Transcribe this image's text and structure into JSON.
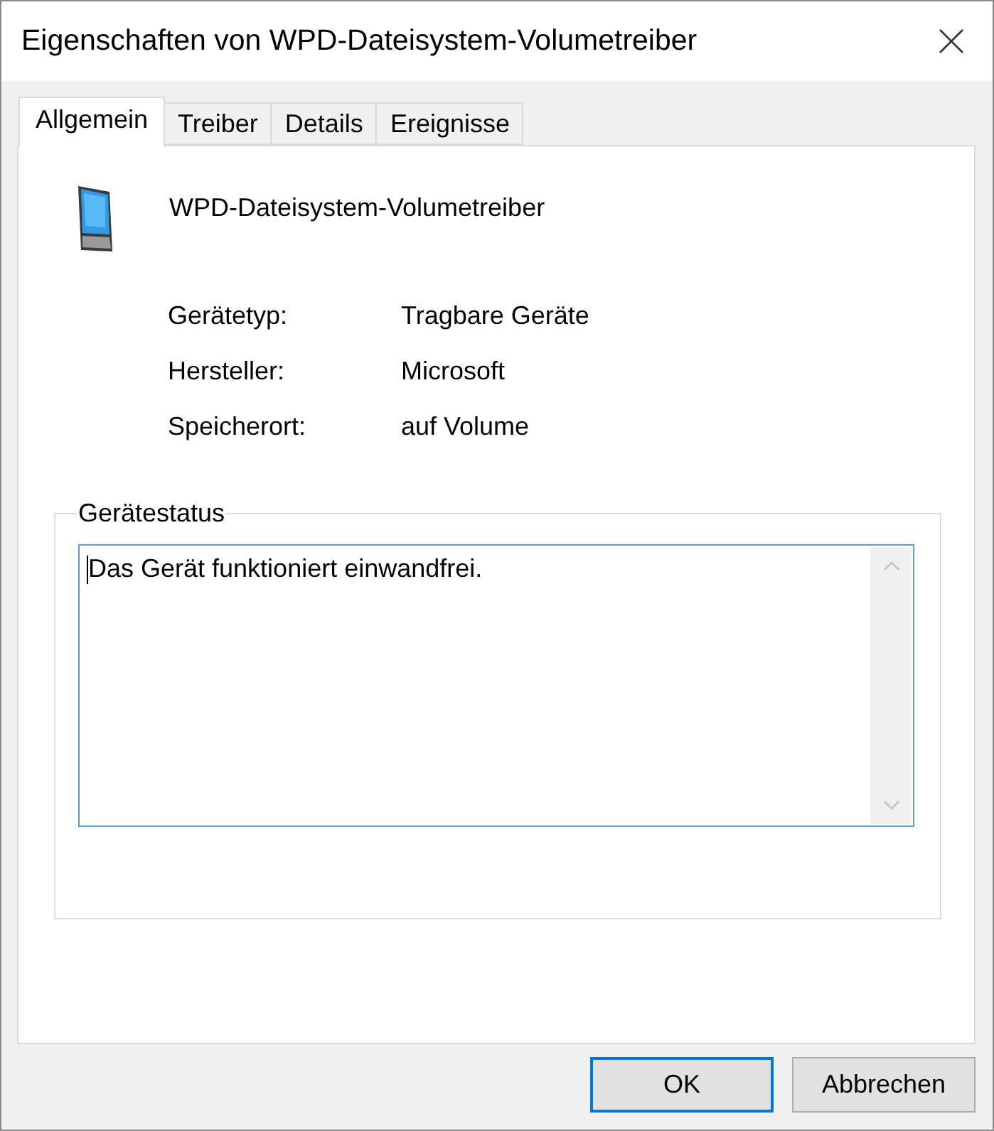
{
  "window": {
    "title": "Eigenschaften von WPD-Dateisystem-Volumetreiber"
  },
  "tabs": [
    {
      "label": "Allgemein",
      "selected": true
    },
    {
      "label": "Treiber",
      "selected": false
    },
    {
      "label": "Details",
      "selected": false
    },
    {
      "label": "Ereignisse",
      "selected": false
    }
  ],
  "device": {
    "name": "WPD-Dateisystem-Volumetreiber"
  },
  "properties": [
    {
      "label": "Gerätetyp:",
      "value": "Tragbare Geräte"
    },
    {
      "label": "Hersteller:",
      "value": "Microsoft"
    },
    {
      "label": "Speicherort:",
      "value": "auf Volume"
    }
  ],
  "status_group": {
    "title": "Gerätestatus",
    "text": "Das Gerät funktioniert einwandfrei.",
    "focused": true
  },
  "buttons": [
    {
      "label": "OK",
      "default": true
    },
    {
      "label": "Abbrechen",
      "default": false
    }
  ]
}
